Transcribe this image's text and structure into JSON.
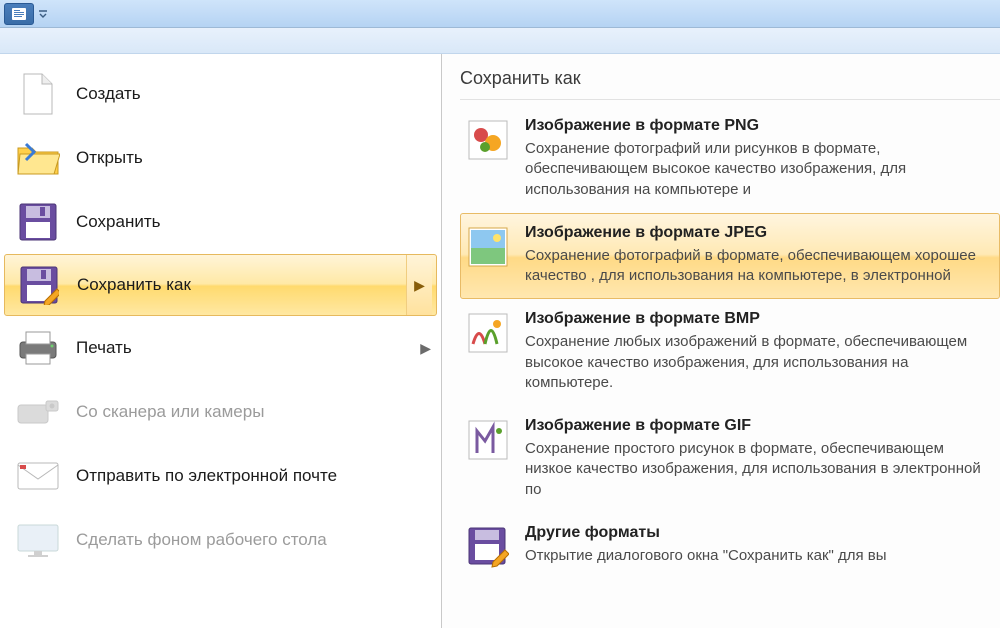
{
  "menu": {
    "items": [
      {
        "id": "new",
        "label": "Создать",
        "submenu": false,
        "disabled": false
      },
      {
        "id": "open",
        "label": "Открыть",
        "submenu": false,
        "disabled": false
      },
      {
        "id": "save",
        "label": "Сохранить",
        "submenu": false,
        "disabled": false
      },
      {
        "id": "saveas",
        "label": "Сохранить как",
        "submenu": true,
        "disabled": false,
        "selected": true
      },
      {
        "id": "print",
        "label": "Печать",
        "submenu": true,
        "disabled": false
      },
      {
        "id": "scan",
        "label": "Со сканера или камеры",
        "submenu": false,
        "disabled": true
      },
      {
        "id": "email",
        "label": "Отправить по электронной почте",
        "submenu": false,
        "disabled": false
      },
      {
        "id": "wall",
        "label": "Сделать фоном рабочего стола",
        "submenu": false,
        "disabled": true
      }
    ]
  },
  "saveas_panel": {
    "title": "Сохранить как",
    "formats": [
      {
        "id": "png",
        "title": "Изображение в формате PNG",
        "desc": "Сохранение фотографий или рисунков в формате, обеспечивающем высокое качество изображения, для использования на компьютере и"
      },
      {
        "id": "jpeg",
        "title": "Изображение в формате JPEG",
        "hover": true,
        "desc": "Сохранение фотографий в формате, обеспечивающем хорошее качество , для использования на компьютере, в электронной"
      },
      {
        "id": "bmp",
        "title": "Изображение в формате BMP",
        "desc": "Сохранение любых изображений в формате, обеспечивающем высокое качество изображения, для использования на компьютере."
      },
      {
        "id": "gif",
        "title": "Изображение в формате GIF",
        "desc": "Сохранение простого рисунок в формате, обеспечивающем низкое качество изображения, для использования в электронной по"
      },
      {
        "id": "other",
        "title": "Другие форматы",
        "desc": "Открытие диалогового окна \"Сохранить как\" для вы"
      }
    ]
  }
}
